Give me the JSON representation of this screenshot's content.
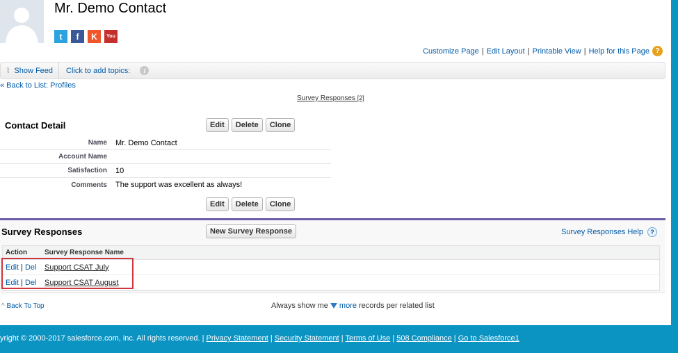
{
  "header": {
    "title": "Mr. Demo Contact",
    "social": [
      "Twitter",
      "Facebook",
      "Klout",
      "YouTube"
    ]
  },
  "toplinks": [
    "Customize Page",
    "Edit Layout",
    "Printable View",
    "Help for this Page"
  ],
  "feed": {
    "show_feed": "Show Feed",
    "topics": "Click to add topics:"
  },
  "back_link": "« Back to List: Profiles",
  "related_link": {
    "label": "Survey Responses",
    "count": "[2]"
  },
  "contact_detail": {
    "heading": "Contact Detail",
    "buttons": [
      "Edit",
      "Delete",
      "Clone"
    ],
    "fields": [
      {
        "label": "Name",
        "value": "Mr. Demo Contact"
      },
      {
        "label": "Account Name",
        "value": ""
      },
      {
        "label": "Satisfaction",
        "value": "10"
      },
      {
        "label": "Comments",
        "value": "The support was excellent as always!"
      }
    ]
  },
  "survey": {
    "heading": "Survey Responses",
    "new_button": "New Survey Response",
    "help": "Survey Responses Help",
    "columns": [
      "Action",
      "Survey Response Name"
    ],
    "rows": [
      {
        "edit": "Edit",
        "del": "Del",
        "name": "Support CSAT July"
      },
      {
        "edit": "Edit",
        "del": "Del",
        "name": "Support CSAT August"
      }
    ]
  },
  "back_to_top": "Back To Top",
  "always": {
    "prefix": "Always show me",
    "more": "more",
    "suffix": "records per related list"
  },
  "footer": {
    "copyright": "yright © 2000-2017 salesforce.com, inc. All rights reserved. |",
    "links": [
      "Privacy Statement",
      "Security Statement",
      "Terms of Use",
      "508 Compliance",
      "Go to Salesforce1"
    ]
  }
}
